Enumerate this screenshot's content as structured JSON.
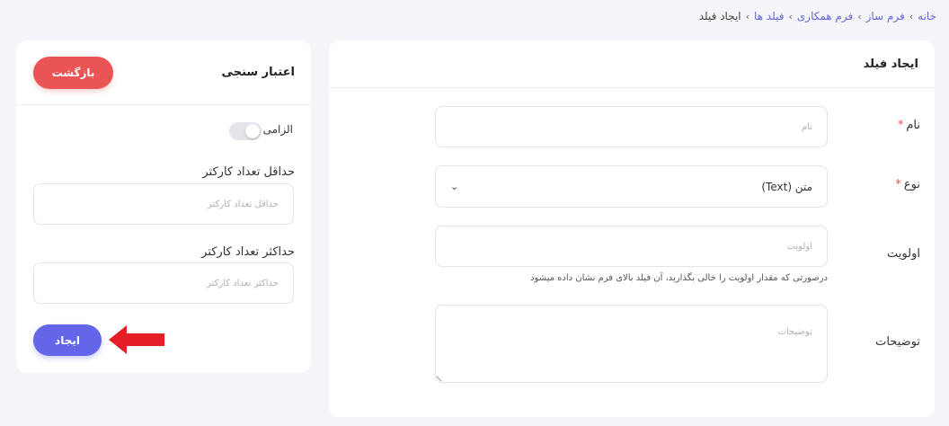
{
  "breadcrumb": {
    "items": [
      "خانه",
      "فرم ساز",
      "فرم همکاری",
      "فیلد ها"
    ],
    "current": "ایجاد فیلد"
  },
  "main_card": {
    "title": "ایجاد فیلد",
    "fields": {
      "name": {
        "label": "نام",
        "required_mark": "*",
        "placeholder": "نام"
      },
      "type": {
        "label": "نوع",
        "required_mark": "*",
        "selected": "متن (Text)",
        "icon": "chevron-down-icon"
      },
      "priority": {
        "label": "اولویت",
        "placeholder": "اولویت",
        "help": "درصورتی که مقدار اولویت را خالی بگذارید، آن فیلد بالای فرم نشان داده میشود"
      },
      "description": {
        "label": "توضیحات",
        "placeholder": "توضیحات"
      }
    }
  },
  "side_card": {
    "title": "اعتبار سنجی",
    "back_label": "بازگشت",
    "required_label": "الزامی",
    "required_on": false,
    "min_chars": {
      "label": "حداقل تعداد کارکتر",
      "placeholder": "حداقل تعداد کارکتر"
    },
    "max_chars": {
      "label": "حداکثر تعداد کارکتر",
      "placeholder": "حداکثر تعداد کارکتر"
    },
    "create_label": "ایجاد"
  },
  "colors": {
    "accent": "#6366e8",
    "danger": "#ea5455",
    "annotation_arrow": "#e51e25"
  }
}
